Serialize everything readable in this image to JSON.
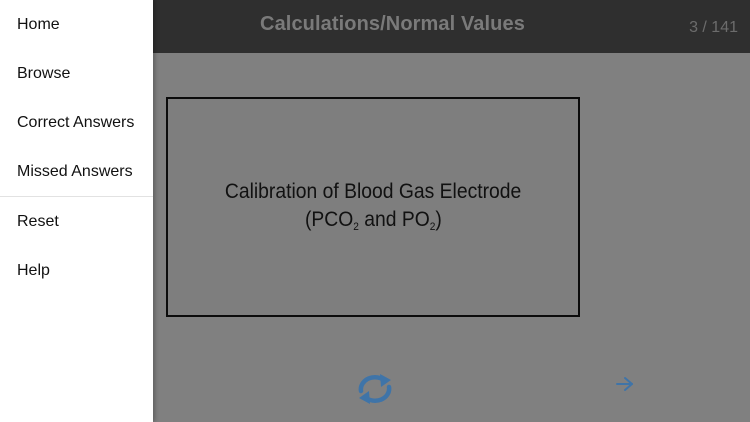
{
  "header": {
    "title": "Calculations/Normal Values",
    "counter": "3 / 141"
  },
  "card": {
    "line1": "Calibration of Blood Gas Electrode",
    "line2_open": "(PCO",
    "line2_sub1": "2",
    "line2_mid": " and PO",
    "line2_sub2": "2",
    "line2_close": ")"
  },
  "controls": {
    "flip_icon": "refresh-icon",
    "next_icon": "arrow-right-icon",
    "accent_color": "#3f74a8"
  },
  "drawer": {
    "items": [
      {
        "label": "Home"
      },
      {
        "label": "Browse"
      },
      {
        "label": "Correct Answers"
      },
      {
        "label": "Missed Answers"
      },
      {
        "label": "Reset"
      },
      {
        "label": "Help"
      }
    ]
  }
}
